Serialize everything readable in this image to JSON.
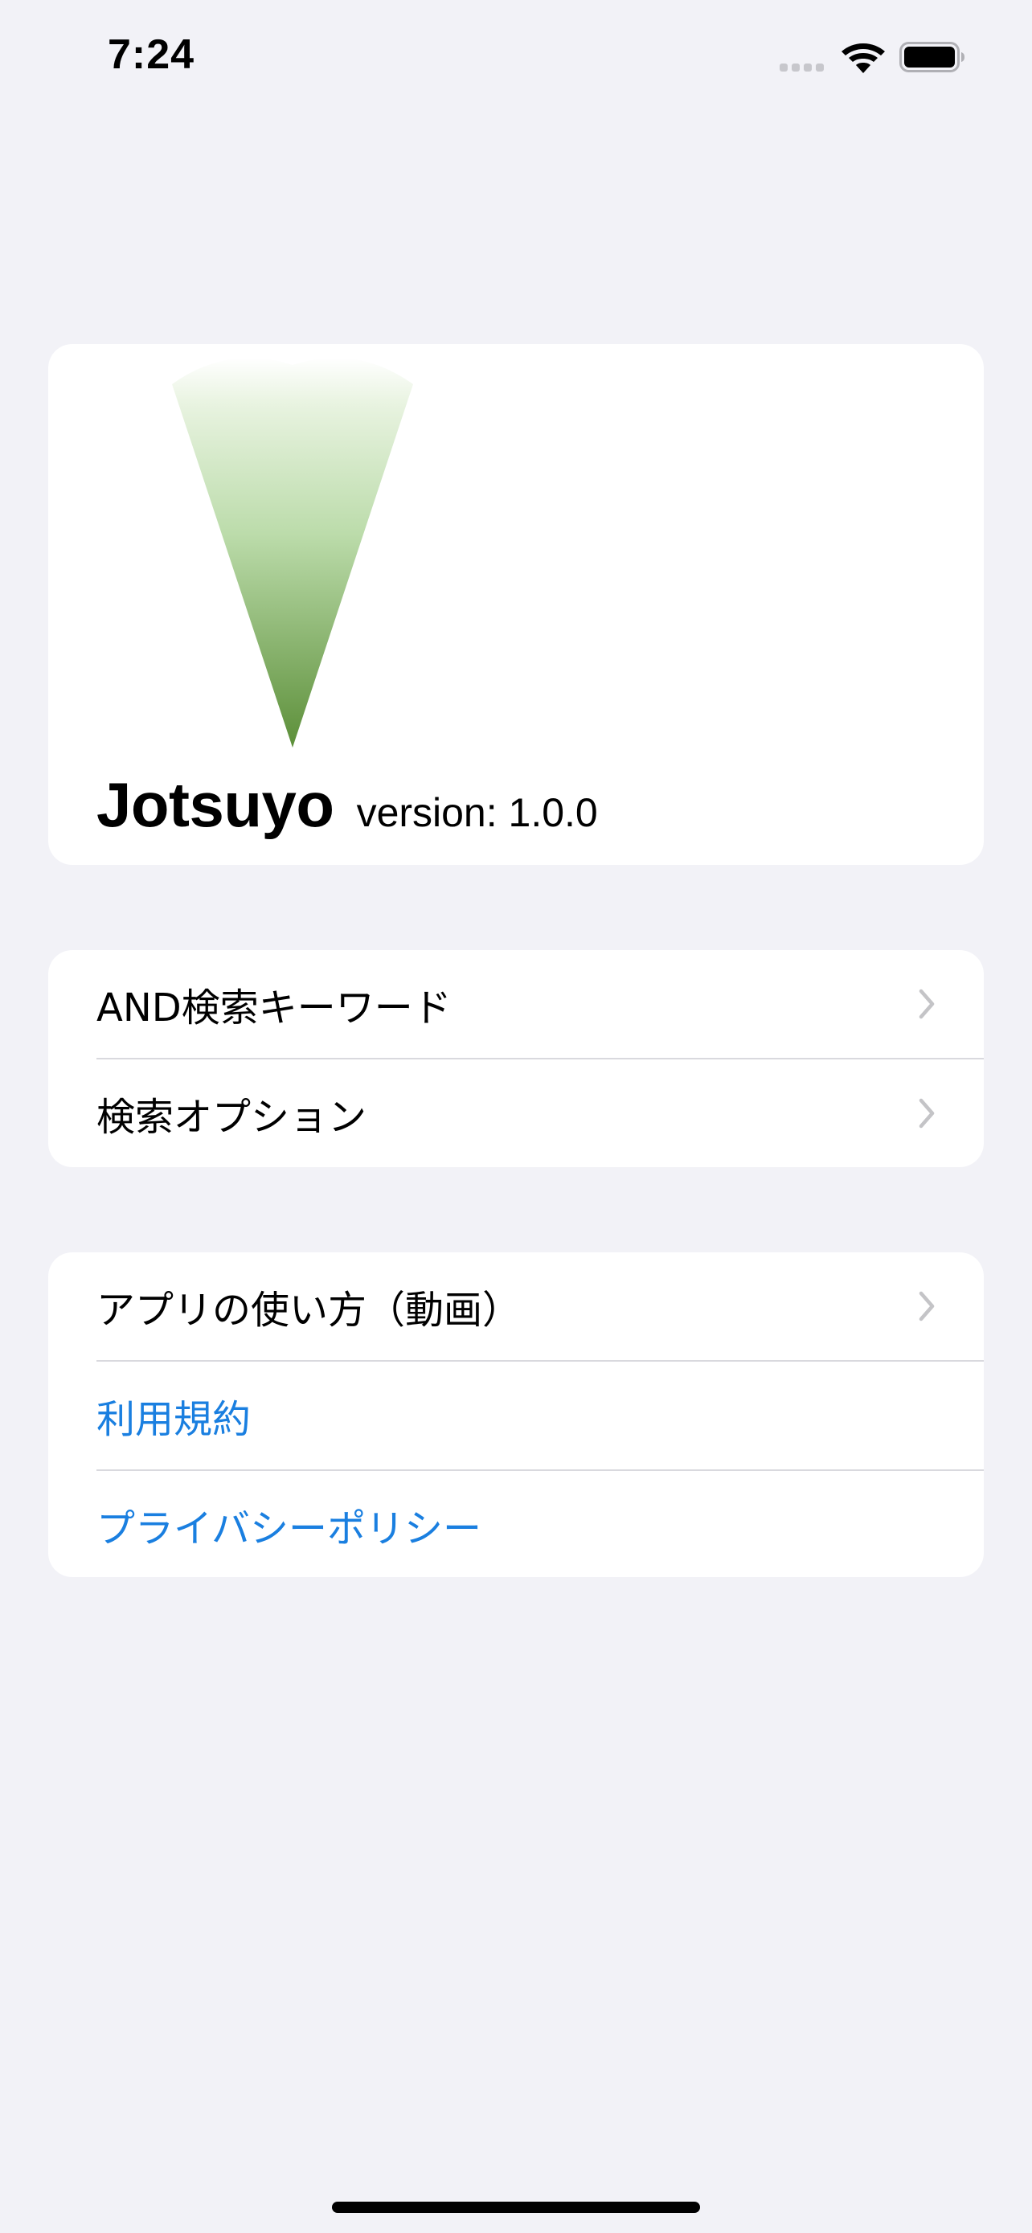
{
  "status_bar": {
    "time": "7:24",
    "icons": [
      "signal-icon",
      "wifi-icon",
      "battery-icon"
    ]
  },
  "header": {
    "app_name": "Jotsuyo",
    "version": "version: 1.0.0",
    "logo": "green-triangle-logo",
    "logo_colors": [
      "#e8f3e0",
      "#bcdcab",
      "#5c8f39"
    ]
  },
  "search_section": {
    "items": [
      {
        "label": "AND検索キーワード",
        "icon": "chevron-right-icon"
      },
      {
        "label": "検索オプション",
        "icon": "chevron-right-icon"
      }
    ]
  },
  "info_section": {
    "items": [
      {
        "label": "アプリの使い方（動画）",
        "icon": "chevron-right-icon"
      },
      {
        "label": "利用規約"
      },
      {
        "label": "プライバシーポリシー"
      }
    ]
  },
  "colors": {
    "background": "#f2f2f7",
    "card": "#ffffff",
    "link": "#1a7fe0",
    "chevron": "#c4c4c7",
    "divider": "#d9d9de"
  }
}
